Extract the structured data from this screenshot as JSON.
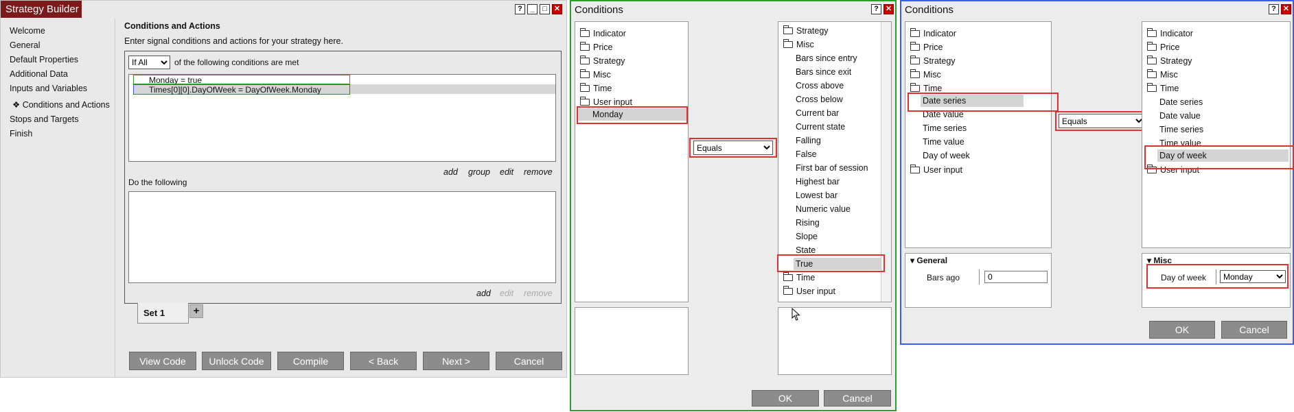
{
  "strategy_builder": {
    "title": "Strategy Builder",
    "nav": [
      "Welcome",
      "General",
      "Default Properties",
      "Additional Data",
      "Inputs and Variables",
      "Conditions and Actions",
      "Stops and Targets",
      "Finish"
    ],
    "nav_active_prefix": "❖",
    "heading": "Conditions and Actions",
    "description": "Enter signal conditions and actions for your strategy here.",
    "if_select": "If All",
    "if_suffix": "of the following conditions are met",
    "conditions": [
      "Monday = true",
      "Times[0][0].DayOfWeek = DayOfWeek.Monday"
    ],
    "cond_links": [
      "add",
      "group",
      "edit",
      "remove"
    ],
    "do_label": "Do the following",
    "action_links": [
      "add",
      "edit",
      "remove"
    ],
    "set_tab": "Set 1",
    "add_tab": "+",
    "buttons": [
      "View Code",
      "Unlock Code",
      "Compile",
      "< Back",
      "Next >",
      "Cancel"
    ],
    "help": "?",
    "min": "_",
    "max": "□",
    "close": "✕"
  },
  "dlg1": {
    "title": "Conditions",
    "left_tree": [
      "Indicator",
      "Price",
      "Strategy",
      "Misc",
      "Time",
      "User input"
    ],
    "left_selected": "Monday",
    "operator": "Equals",
    "right_tree_top": [
      "Strategy",
      "Misc"
    ],
    "right_misc_items": [
      "Bars since entry",
      "Bars since exit",
      "Cross above",
      "Cross below",
      "Current bar",
      "Current state",
      "Falling",
      "False",
      "First bar of session",
      "Highest bar",
      "Lowest bar",
      "Numeric value",
      "Rising",
      "Slope",
      "State",
      "True"
    ],
    "right_tree_bottom": [
      "Time",
      "User input"
    ],
    "ok": "OK",
    "cancel": "Cancel",
    "help": "?",
    "close": "✕"
  },
  "dlg2": {
    "title": "Conditions",
    "left_tree": [
      "Indicator",
      "Price",
      "Strategy",
      "Misc",
      "Time"
    ],
    "left_time_items": [
      "Date series",
      "Date value",
      "Time series",
      "Time value",
      "Day of week"
    ],
    "left_tree_bottom": [
      "User input"
    ],
    "operator": "Equals",
    "right_tree": [
      "Indicator",
      "Price",
      "Strategy",
      "Misc",
      "Time"
    ],
    "right_time_items": [
      "Date series",
      "Date value",
      "Time series",
      "Time value",
      "Day of week"
    ],
    "right_tree_bottom": [
      "User input"
    ],
    "general_label": "General",
    "bars_ago_label": "Bars ago",
    "bars_ago_value": "0",
    "misc_label": "Misc",
    "dow_label": "Day of week",
    "dow_value": "Monday",
    "ok": "OK",
    "cancel": "Cancel",
    "help": "?",
    "close": "✕"
  },
  "colors": {
    "title_tab": "#7a1a1a",
    "green_frame": "#2aa02a",
    "blue_frame": "#3a5cf0",
    "red_highlight": "#e03030"
  }
}
